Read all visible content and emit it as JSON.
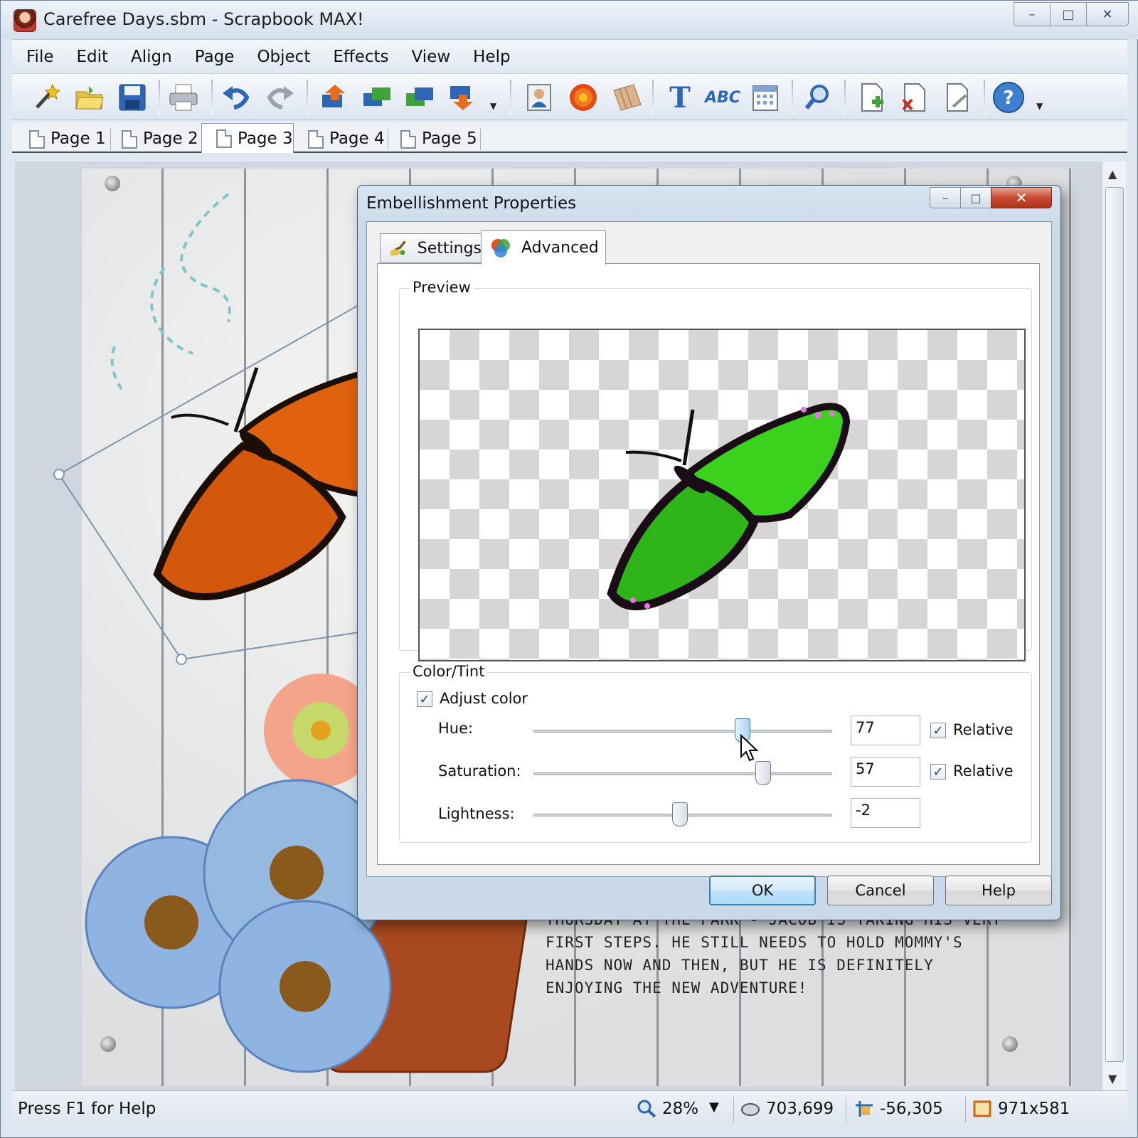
{
  "window": {
    "title": "Carefree Days.sbm - Scrapbook MAX!",
    "controls": {
      "minimize": "–",
      "maximize": "□",
      "close": "✕"
    }
  },
  "menu": [
    "File",
    "Edit",
    "Align",
    "Page",
    "Object",
    "Effects",
    "View",
    "Help"
  ],
  "toolbar": {
    "icons": [
      "magic-wand-icon",
      "open-folder-icon",
      "save-icon",
      "print-icon",
      "undo-icon",
      "redo-icon",
      "bring-forward-icon",
      "send-forward-icon",
      "send-backward-icon",
      "send-back-icon",
      "photo-icon",
      "flower-embellishment-icon",
      "paper-icon",
      "text-icon",
      "word-art-icon",
      "calendar-icon",
      "zoom-icon",
      "add-page-icon",
      "delete-page-icon",
      "page-properties-icon",
      "help-icon"
    ],
    "text_glyph": "T",
    "abc_glyph": "ABC"
  },
  "page_tabs": [
    "Page 1",
    "Page 2",
    "Page 3",
    "Page 4",
    "Page 5"
  ],
  "active_page_tab": "Page 3",
  "journal": {
    "lines": [
      "THURSDAY AT THE PARK - JACOB IS TAKING HIS VERY",
      "FIRST STEPS. HE STILL NEEDS TO HOLD MOMMY'S",
      "HANDS NOW AND THEN, BUT HE IS DEFINITELY",
      "ENJOYING THE NEW ADVENTURE!"
    ]
  },
  "dialog": {
    "title": "Embellishment Properties",
    "tabs": [
      "Settings",
      "Advanced"
    ],
    "active_tab": "Advanced",
    "preview_label": "Preview",
    "color_group_label": "Color/Tint",
    "adjust_color": {
      "label": "Adjust color",
      "checked": true
    },
    "hue": {
      "label": "Hue:",
      "value": "77",
      "relative_label": "Relative",
      "relative": true,
      "fraction": 0.7
    },
    "saturation": {
      "label": "Saturation:",
      "value": "57",
      "relative_label": "Relative",
      "relative": true,
      "fraction": 0.77
    },
    "lightness": {
      "label": "Lightness:",
      "value": "-2",
      "fraction": 0.49
    },
    "buttons": {
      "ok": "OK",
      "cancel": "Cancel",
      "help": "Help"
    },
    "controls": {
      "minimize": "–",
      "maximize": "□",
      "close": "✕"
    },
    "check_glyph": "✓"
  },
  "status": {
    "help_text": "Press F1 for Help",
    "zoom": "28%",
    "zoom_dropdown": "▼",
    "cursor_pos": "703,699",
    "object_pos": "-56,305",
    "object_size": "971x581"
  },
  "colors": {
    "accent": "#3c7fb1",
    "close_red": "#c74a31",
    "butterfly_orange": "#e0620f",
    "butterfly_green": "#3ad21c",
    "daisy_blue": "#8fb4e2"
  }
}
